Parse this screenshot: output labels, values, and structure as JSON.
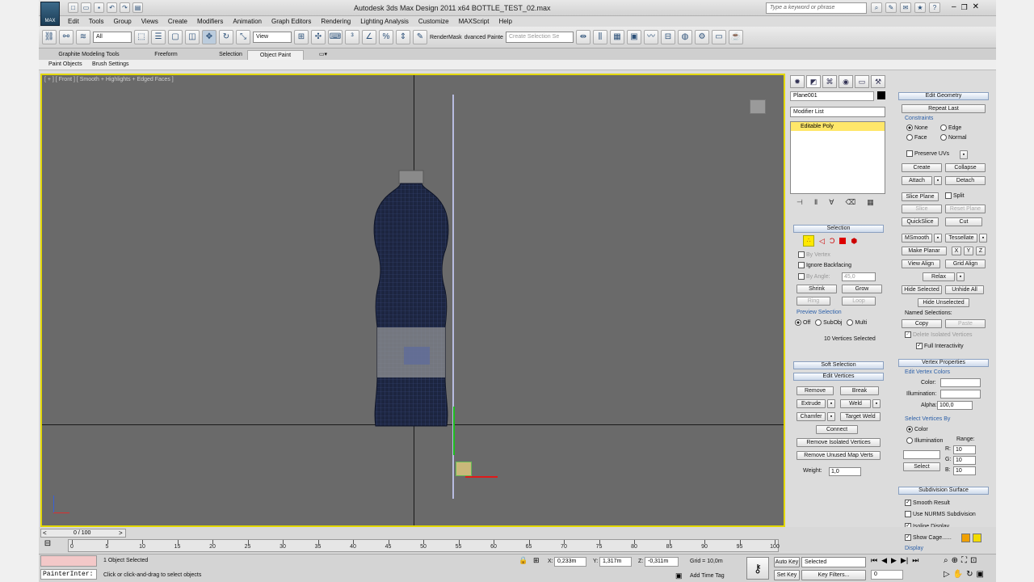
{
  "window": {
    "title": "Autodesk 3ds Max Design 2011 x64     BOTTLE_TEST_02.max",
    "search_placeholder": "Type a keyword or phrase",
    "logo_text": "MAX"
  },
  "menu": [
    "Edit",
    "Tools",
    "Group",
    "Views",
    "Create",
    "Modifiers",
    "Animation",
    "Graph Editors",
    "Rendering",
    "Lighting Analysis",
    "Customize",
    "MAXScript",
    "Help"
  ],
  "toolbar": {
    "filter": "All",
    "refcoord": "View",
    "rendermask": "RenderMask",
    "advanced": "dvanced Painte",
    "selset_placeholder": "Create Selection Se"
  },
  "ribbon": {
    "tabs": [
      "Graphite Modeling Tools",
      "Freeform",
      "Selection",
      "Object Paint"
    ],
    "active_tab": "Object Paint",
    "subtabs": [
      "Paint Objects",
      "Brush Settings"
    ]
  },
  "viewport": {
    "label": "[ + ] [ Front ] [ Smooth + Highlights + Edged Faces ]"
  },
  "panel": {
    "object_name": "Plane001",
    "modifier_list": "Modifier List",
    "stack_item": "Editable Poly",
    "selection": {
      "title": "Selection",
      "by_vertex": "By Vertex",
      "ignore_backfacing": "Ignore Backfacing",
      "by_angle": "By Angle:",
      "angle_value": "45,0",
      "shrink": "Shrink",
      "grow": "Grow",
      "ring": "Ring",
      "loop": "Loop",
      "preview_selection": "Preview Selection",
      "off": "Off",
      "subobj": "SubObj",
      "multi": "Multi",
      "status": "10 Vertices Selected"
    },
    "soft_selection": "Soft Selection",
    "edit_vertices": {
      "title": "Edit Vertices",
      "remove": "Remove",
      "break": "Break",
      "extrude": "Extrude",
      "weld": "Weld",
      "chamfer": "Chamfer",
      "target_weld": "Target Weld",
      "connect": "Connect",
      "remove_isolated": "Remove Isolated Vertices",
      "remove_unused": "Remove Unused Map Verts",
      "weight_label": "Weight:",
      "weight_value": "1,0"
    },
    "edit_geometry": {
      "title": "Edit Geometry",
      "repeat_last": "Repeat Last",
      "constraints": "Constraints",
      "none": "None",
      "edge": "Edge",
      "face": "Face",
      "normal": "Normal",
      "preserve_uvs": "Preserve UVs",
      "create": "Create",
      "collapse": "Collapse",
      "attach": "Attach",
      "detach": "Detach",
      "slice_plane": "Slice Plane",
      "split": "Split",
      "slice": "Slice",
      "reset_plane": "Reset Plane",
      "quickslice": "QuickSlice",
      "cut": "Cut",
      "msmooth": "MSmooth",
      "tessellate": "Tessellate",
      "make_planar": "Make Planar",
      "x": "X",
      "y": "Y",
      "z": "Z",
      "view_align": "View Align",
      "grid_align": "Grid Align",
      "relax": "Relax",
      "hide_selected": "Hide Selected",
      "unhide_all": "Unhide All",
      "hide_unselected": "Hide Unselected",
      "named_selections": "Named Selections:",
      "copy": "Copy",
      "paste": "Paste",
      "delete_isolated": "Delete Isolated Vertices",
      "full_interactivity": "Full Interactivity"
    },
    "vertex_properties": {
      "title": "Vertex Properties",
      "edit_colors": "Edit Vertex Colors",
      "color": "Color:",
      "illumination": "Illumination:",
      "alpha": "Alpha:",
      "alpha_value": "100,0",
      "select_by": "Select Vertices By",
      "color_opt": "Color",
      "illum_opt": "Illumination",
      "range": "Range:",
      "r": "R:",
      "g": "G:",
      "b": "B:",
      "r_val": "10",
      "g_val": "10",
      "b_val": "10",
      "select": "Select"
    },
    "subdivision": {
      "title": "Subdivision Surface",
      "smooth_result": "Smooth Result",
      "use_nurms": "Use NURMS Subdivision",
      "isoline": "Isoline Display",
      "show_cage": "Show Cage......",
      "display": "Display"
    }
  },
  "timeline": {
    "frame": "0 / 100",
    "ticks": [
      "0",
      "5",
      "10",
      "15",
      "20",
      "25",
      "30",
      "35",
      "40",
      "45",
      "50",
      "55",
      "60",
      "65",
      "70",
      "75",
      "80",
      "85",
      "90",
      "95",
      "100"
    ]
  },
  "status": {
    "maxscript": "PainterInter:",
    "selected": "1 Object Selected",
    "prompt": "Click or click-and-drag to select objects",
    "x_label": "X:",
    "x": "0,233m",
    "y_label": "Y:",
    "y": "1,317m",
    "z_label": "Z:",
    "z": "-0,311m",
    "grid": "Grid = 10,0m",
    "add_time_tag": "Add Time Tag",
    "auto_key": "Auto Key",
    "set_key": "Set Key",
    "key_mode": "Selected",
    "key_filters": "Key Filters...",
    "frame_value": "0"
  }
}
